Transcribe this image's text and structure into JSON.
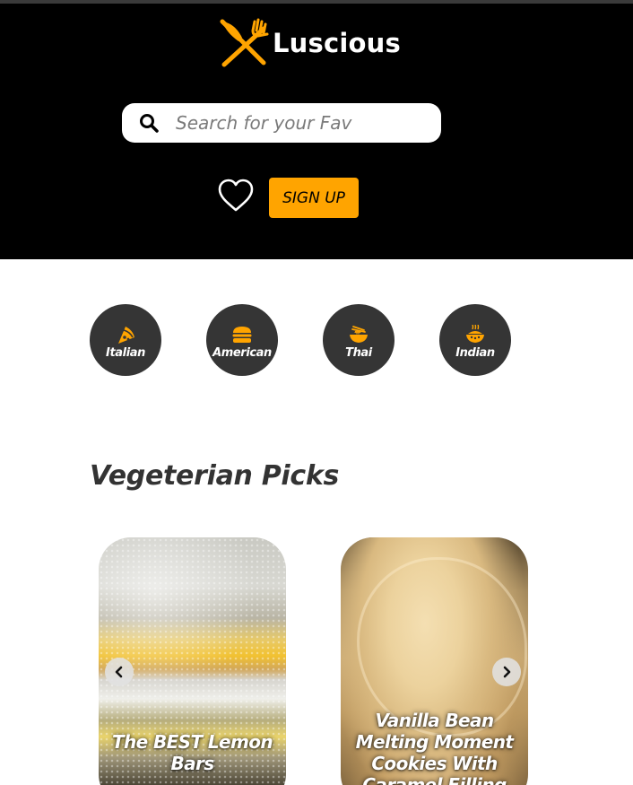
{
  "brand": {
    "name": "Luscious"
  },
  "search": {
    "placeholder": "Search for your Fav"
  },
  "header": {
    "signup_label": "SIGN UP"
  },
  "categories": [
    {
      "label": "Italian",
      "icon": "pizza-slice-icon"
    },
    {
      "label": "American",
      "icon": "hamburger-icon"
    },
    {
      "label": "Thai",
      "icon": "noodle-bowl-icon"
    },
    {
      "label": "Indian",
      "icon": "curry-bowl-icon"
    }
  ],
  "section": {
    "title": "Vegeterian Picks"
  },
  "cards": [
    {
      "title": "The BEST Lemon Bars"
    },
    {
      "title": "Vanilla Bean Melting Moment Cookies With Caramel Filling"
    }
  ],
  "colors": {
    "accent": "#ffa400",
    "header_bg": "#000000",
    "category_bg": "#353535"
  }
}
